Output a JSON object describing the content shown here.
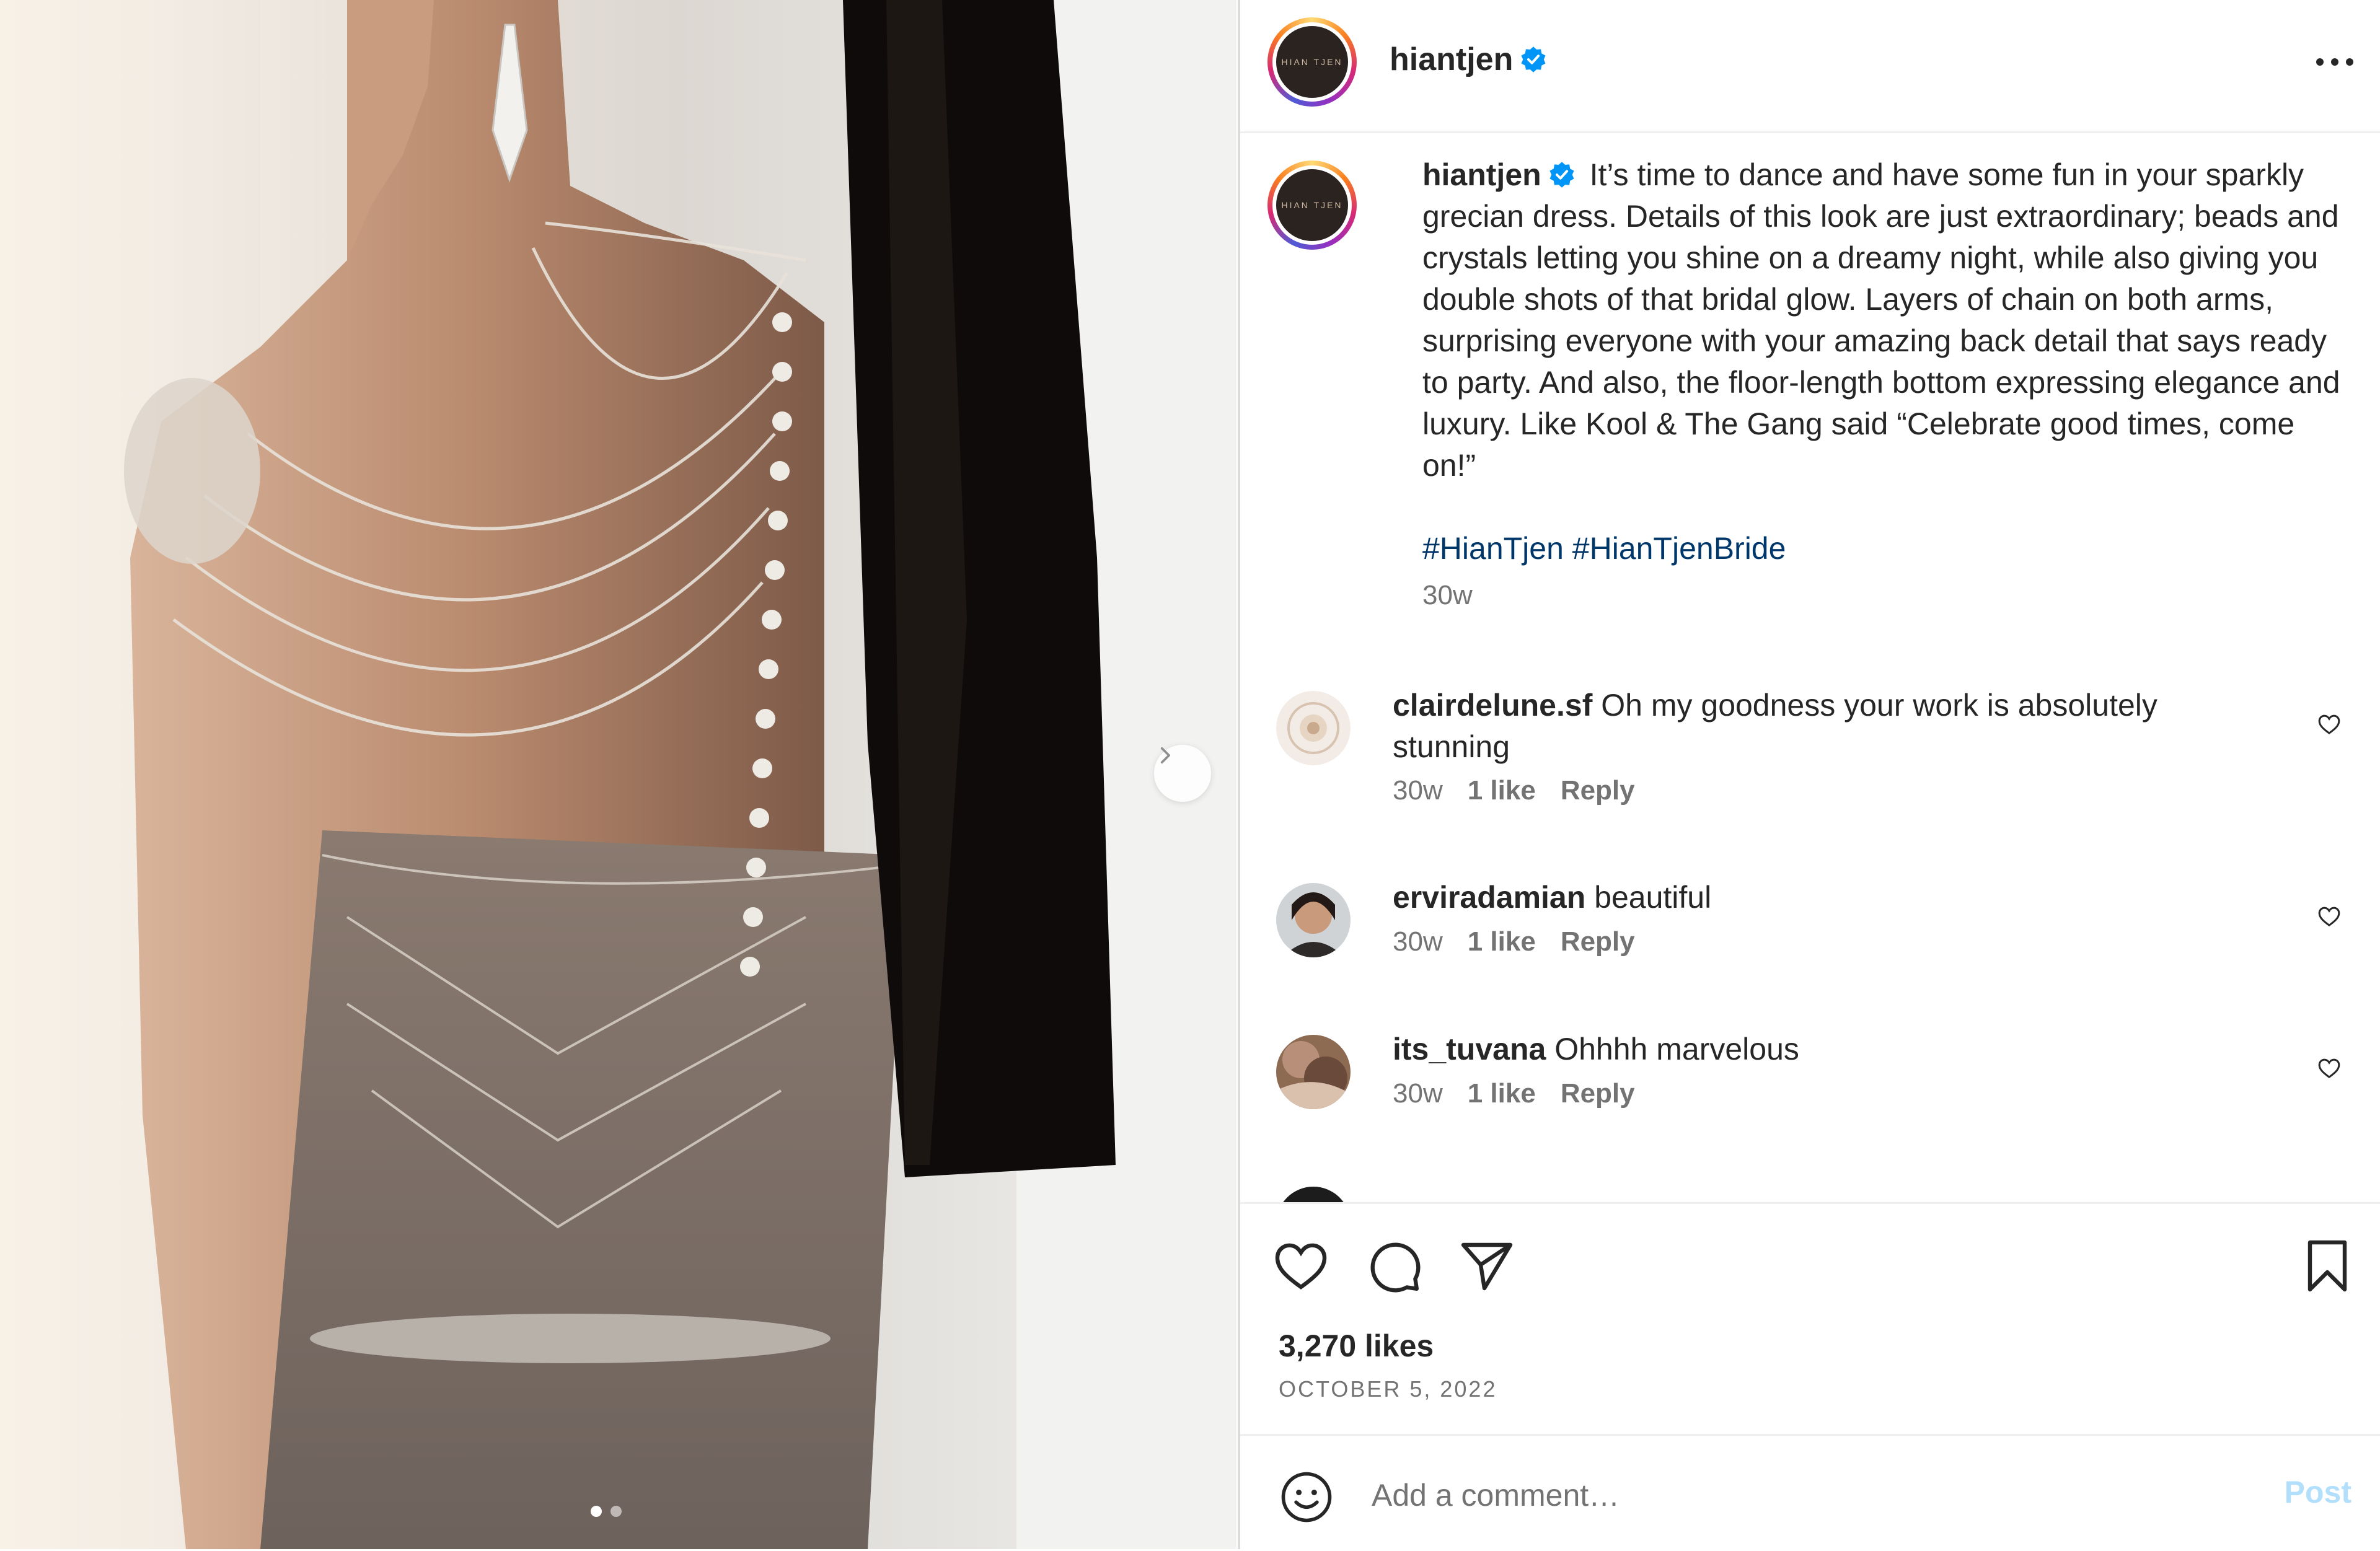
{
  "post": {
    "author": "hiantjen",
    "avatar_logo_text": "HIAN TJEN",
    "verified": true,
    "media": {
      "slide_count": 2,
      "active_slide": 1
    }
  },
  "caption": {
    "username": "hiantjen",
    "text": "It’s time to dance and have some fun in your sparkly grecian dress. Details of this look are just extraordinary; beads and crystals letting you shine on a dreamy night, while also giving you double shots of that bridal glow. Layers of chain on both arms, surprising everyone with your amazing back detail that says ready to party. And also, the floor-length bottom expressing elegance and luxury. Like Kool & The Gang said “Celebrate good times, come on!”",
    "hashtags": "#HianTjen #HianTjenBride",
    "time": "30w"
  },
  "comments": [
    {
      "username": "clairdelune.sf",
      "text": "Oh my goodness your work is absolutely stunning",
      "time": "30w",
      "likes": "1 like",
      "reply_label": "Reply"
    },
    {
      "username": "erviradamian",
      "text": "beautiful",
      "time": "30w",
      "likes": "1 like",
      "reply_label": "Reply"
    },
    {
      "username": "its_tuvana",
      "text": "Ohhhh marvelous",
      "time": "30w",
      "likes": "1 like",
      "reply_label": "Reply"
    }
  ],
  "actions": {
    "likes": "3,270 likes",
    "date": "OCTOBER 5, 2022"
  },
  "add_comment": {
    "placeholder": "Add a comment…",
    "post_label": "Post"
  },
  "icons": {
    "more": "more-horizontal-icon",
    "like": "heart-icon",
    "comment": "comment-bubble-icon",
    "share": "paper-plane-icon",
    "save": "bookmark-icon",
    "emoji": "smiley-icon",
    "next": "chevron-right-icon"
  },
  "colors": {
    "link": "#00376b",
    "verified": "#0095f6",
    "muted": "#737373",
    "post_button_disabled": "#b2dffc",
    "divider": "#efefef"
  }
}
